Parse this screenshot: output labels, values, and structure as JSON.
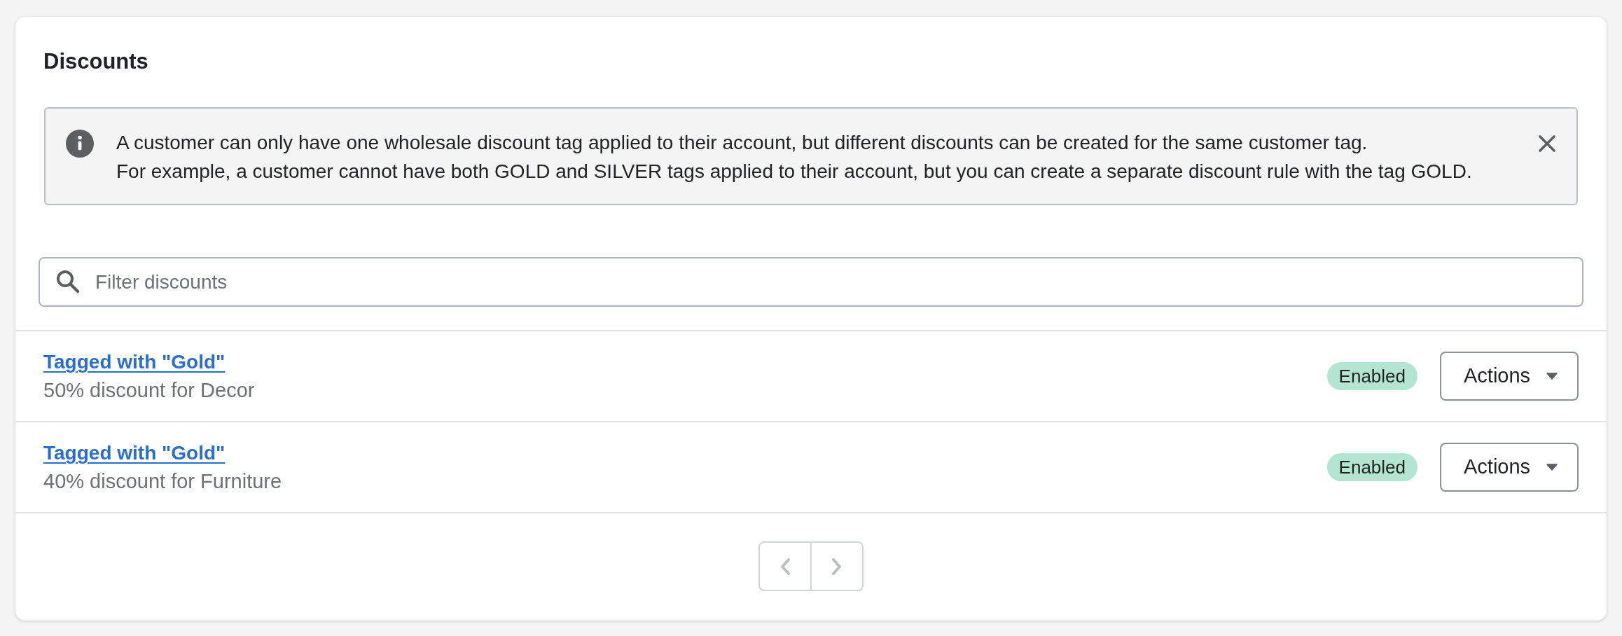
{
  "card": {
    "title": "Discounts"
  },
  "banner": {
    "lines": [
      "A customer can only have one wholesale discount tag applied to their account, but different discounts can be created for the same customer tag.",
      "For example, a customer cannot have both GOLD and SILVER tags applied to their account, but you can create a separate discount rule with the tag GOLD."
    ]
  },
  "search": {
    "placeholder": "Filter discounts"
  },
  "discounts": [
    {
      "title": "Tagged with \"Gold\"",
      "description": "50% discount for Decor",
      "status": "Enabled",
      "action": "Actions"
    },
    {
      "title": "Tagged with \"Gold\"",
      "description": "40% discount for Furniture",
      "status": "Enabled",
      "action": "Actions"
    }
  ],
  "pagination": {
    "previous": {
      "disabled": true
    },
    "next": {
      "disabled": true
    }
  }
}
